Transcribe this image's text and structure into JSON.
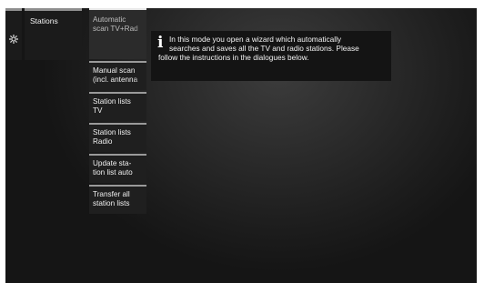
{
  "breadcrumb": {
    "settings_icon": "gear-icon",
    "current": "Stations"
  },
  "menu": {
    "items": [
      {
        "line1": "Automatic",
        "line2": "scan TV+Rad",
        "selected": true
      },
      {
        "line1": "Manual scan",
        "line2": "(incl. antenna"
      },
      {
        "line1": "Station lists",
        "line2": "TV"
      },
      {
        "line1": "Station lists",
        "line2": "Radio"
      },
      {
        "line1": "Update sta-",
        "line2": "tion list auto"
      },
      {
        "line1": "Transfer all",
        "line2": "station lists"
      }
    ]
  },
  "info": {
    "icon": "info-icon",
    "line1": "In this mode you open a wizard which automatically",
    "line2": "searches and saves all the TV and radio stations. Please",
    "line3": "follow the instructions in the dialogues below."
  }
}
